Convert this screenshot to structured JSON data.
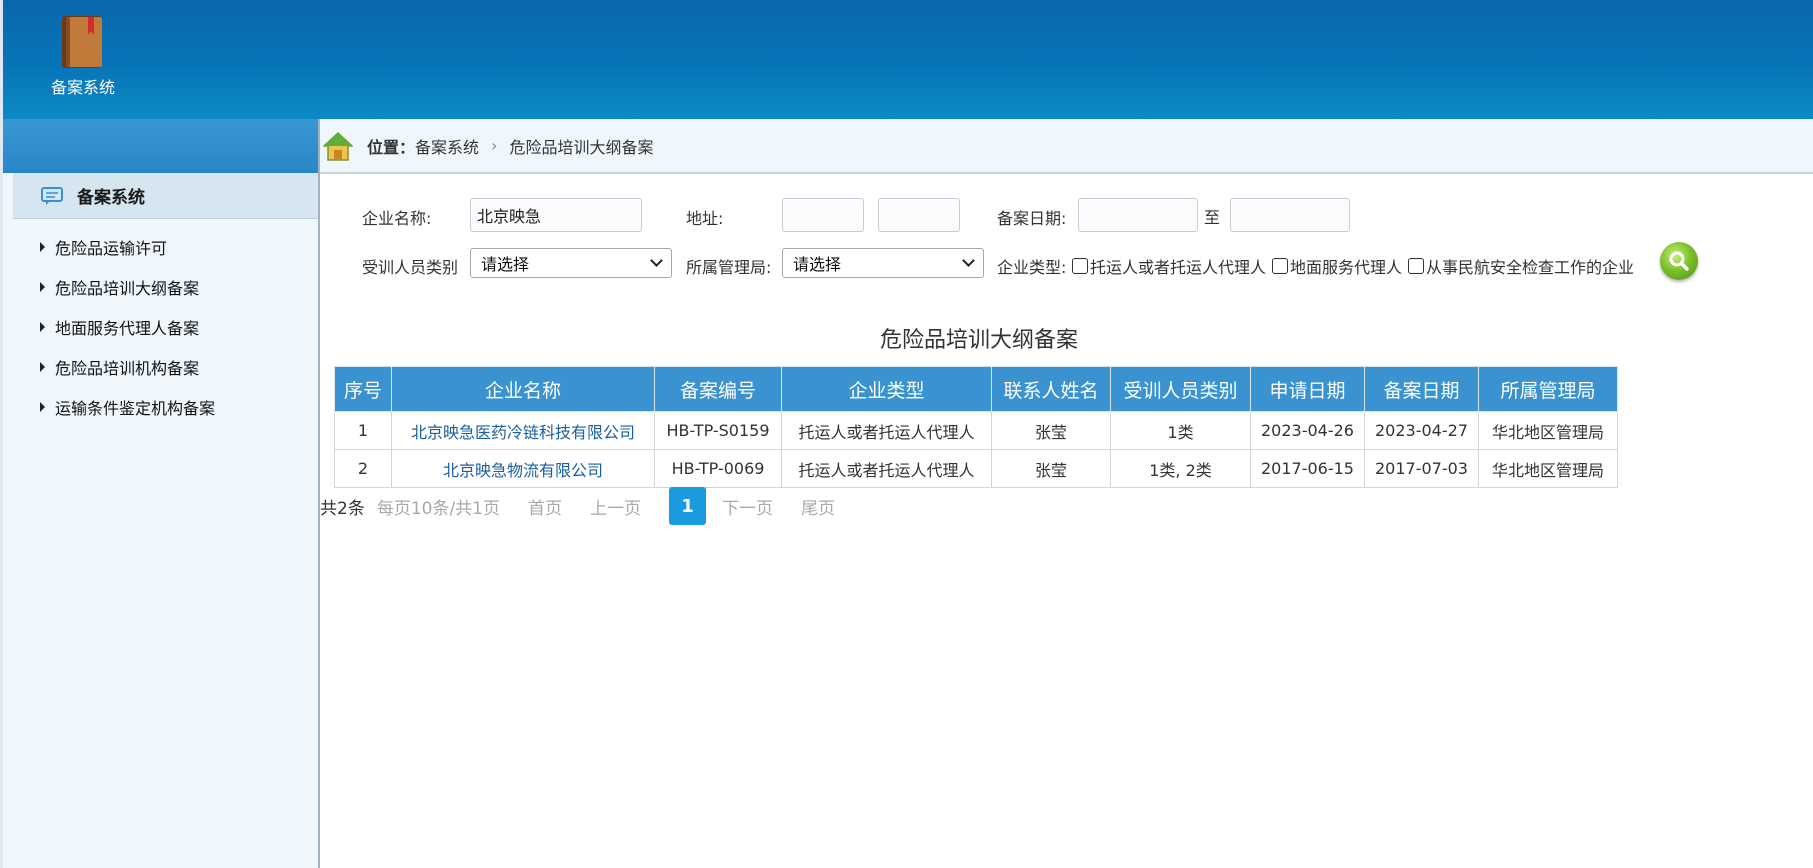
{
  "header": {
    "app_title": "备案系统",
    "logo_icon": "book-icon"
  },
  "sidebar": {
    "group_label": "备案系统",
    "items": [
      {
        "label": "危险品运输许可"
      },
      {
        "label": "危险品培训大纲备案"
      },
      {
        "label": "地面服务代理人备案"
      },
      {
        "label": "危险品培训机构备案"
      },
      {
        "label": "运输条件鉴定机构备案"
      }
    ]
  },
  "breadcrumb": {
    "location_label": "位置：",
    "items": [
      "备案系统",
      "危险品培训大纲备案"
    ],
    "separator": "›"
  },
  "search": {
    "company_label": "企业名称:",
    "company_value": "北京映急",
    "address_label": "地址:",
    "date_label": "备案日期:",
    "date_to_label": "至",
    "trainee_label": "受训人员类别",
    "trainee_value": "请选择",
    "bureau_label": "所属管理局:",
    "bureau_value": "请选择",
    "type_label": "企业类型:",
    "type_options": [
      "托运人或者托运人代理人",
      "地面服务代理人",
      "从事民航安全检查工作的企业"
    ]
  },
  "table": {
    "title": "危险品培训大纲备案",
    "headers": [
      "序号",
      "企业名称",
      "备案编号",
      "企业类型",
      "联系人姓名",
      "受训人员类别",
      "申请日期",
      "备案日期",
      "所属管理局"
    ],
    "rows": [
      [
        "1",
        "北京映急医药冷链科技有限公司",
        "HB-TP-S0159",
        "托运人或者托运人代理人",
        "张莹",
        "1类",
        "2023-04-26",
        "2023-04-27",
        "华北地区管理局"
      ],
      [
        "2",
        "北京映急物流有限公司",
        "HB-TP-0069",
        "托运人或者托运人代理人",
        "张莹",
        "1类, 2类",
        "2017-06-15",
        "2017-07-03",
        "华北地区管理局"
      ]
    ]
  },
  "pager": {
    "total": "共2条",
    "per_page": "每页10条/共1页",
    "first": "首页",
    "prev": "上一页",
    "current": "1",
    "next": "下一页",
    "last": "尾页"
  },
  "colors": {
    "header_blue": "#0874b8",
    "table_header": "#3a92d0",
    "link": "#1a5fa0",
    "page_active": "#1a9be0"
  }
}
